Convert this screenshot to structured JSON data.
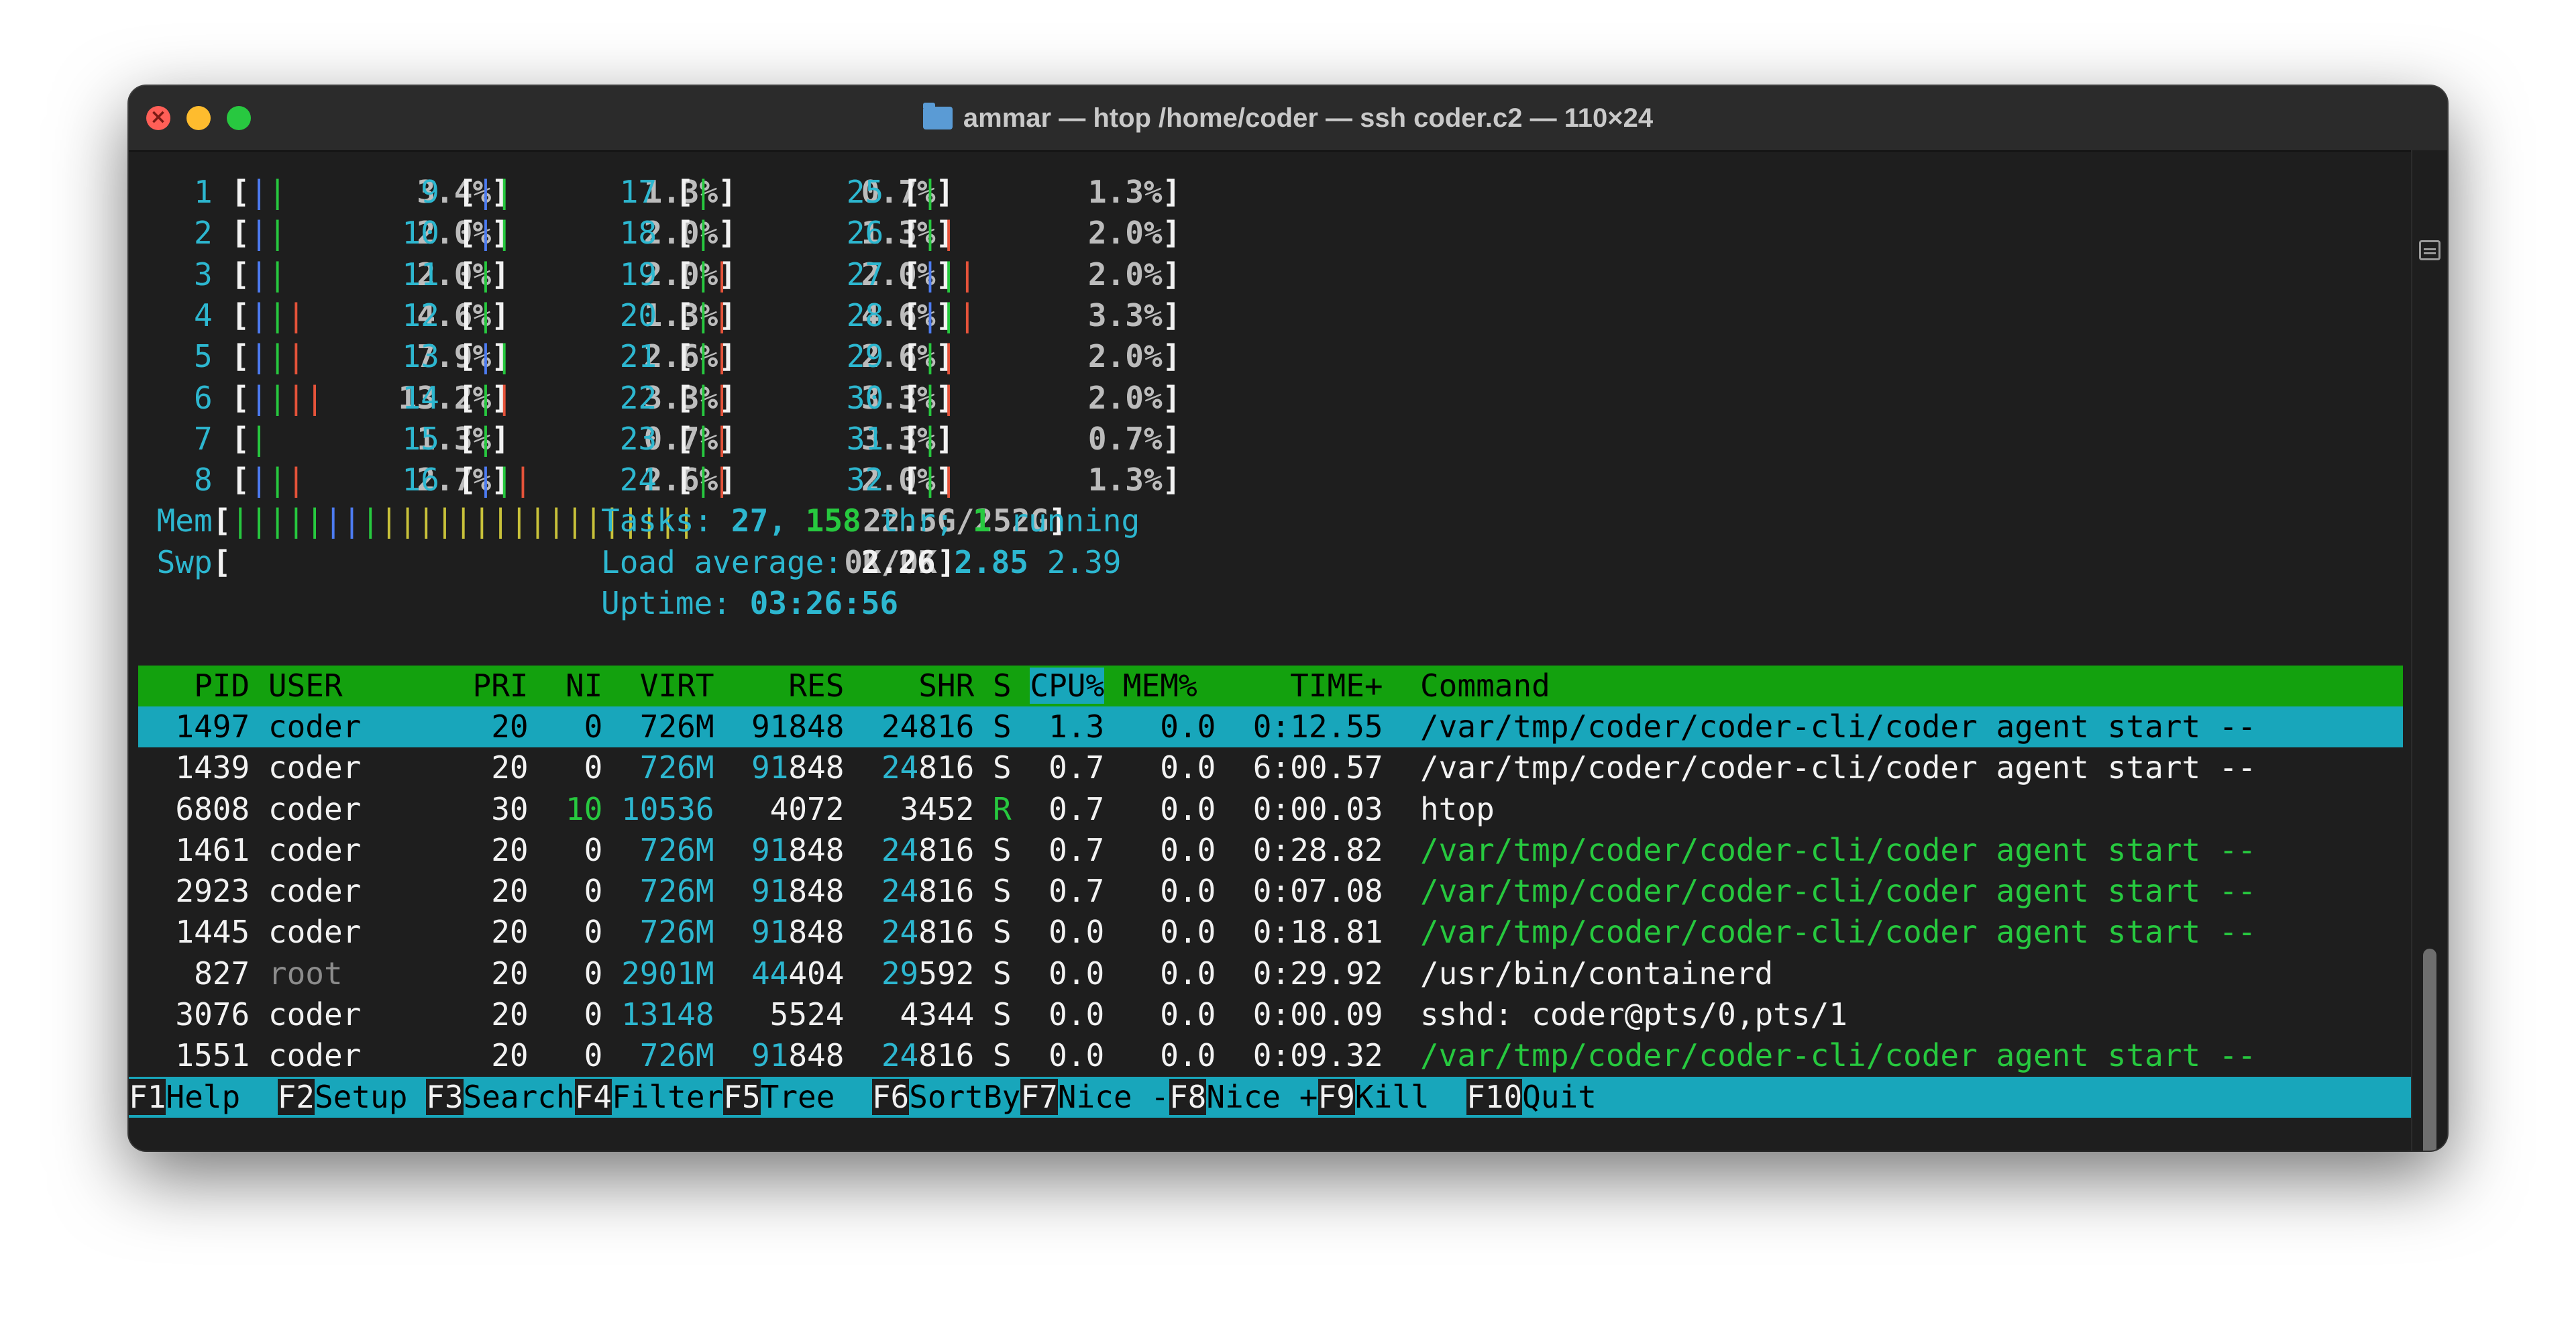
{
  "window": {
    "title": "ammar — htop /home/coder — ssh coder.c2 — 110×24",
    "folder_icon": "folder-icon"
  },
  "cpus": [
    {
      "id": "1",
      "bars": "||",
      "pct": "3.4%"
    },
    {
      "id": "2",
      "bars": "||",
      "pct": "2.0%"
    },
    {
      "id": "3",
      "bars": "||",
      "pct": "2.0%"
    },
    {
      "id": "4",
      "bars": "|||",
      "pct": "4.6%"
    },
    {
      "id": "5",
      "bars": "|||",
      "pct": "7.9%"
    },
    {
      "id": "6",
      "bars": "||||",
      "pct": "13.2%"
    },
    {
      "id": "7",
      "bars": "|",
      "pct": "1.3%"
    },
    {
      "id": "8",
      "bars": "|||",
      "pct": "2.7%"
    },
    {
      "id": "9",
      "bars": "||",
      "pct": "1.3%"
    },
    {
      "id": "10",
      "bars": "||",
      "pct": "2.0%"
    },
    {
      "id": "11",
      "bars": "|",
      "pct": "2.0%"
    },
    {
      "id": "12",
      "bars": "|",
      "pct": "1.3%"
    },
    {
      "id": "13",
      "bars": "||",
      "pct": "2.6%"
    },
    {
      "id": "14",
      "bars": "||",
      "pct": "3.3%"
    },
    {
      "id": "15",
      "bars": "|",
      "pct": "0.7%"
    },
    {
      "id": "16",
      "bars": "|||",
      "pct": "2.6%"
    },
    {
      "id": "17",
      "bars": "|",
      "pct": "0.7%"
    },
    {
      "id": "18",
      "bars": "|",
      "pct": "1.3%"
    },
    {
      "id": "19",
      "bars": "||",
      "pct": "2.0%"
    },
    {
      "id": "20",
      "bars": "||",
      "pct": "4.6%"
    },
    {
      "id": "21",
      "bars": "||",
      "pct": "2.6%"
    },
    {
      "id": "22",
      "bars": "||",
      "pct": "3.3%"
    },
    {
      "id": "23",
      "bars": "||",
      "pct": "3.3%"
    },
    {
      "id": "24",
      "bars": "||",
      "pct": "2.0%"
    },
    {
      "id": "25",
      "bars": "|",
      "pct": "1.3%"
    },
    {
      "id": "26",
      "bars": "||",
      "pct": "2.0%"
    },
    {
      "id": "27",
      "bars": "|||",
      "pct": "2.0%"
    },
    {
      "id": "28",
      "bars": "|||",
      "pct": "3.3%"
    },
    {
      "id": "29",
      "bars": "||",
      "pct": "2.0%"
    },
    {
      "id": "30",
      "bars": "||",
      "pct": "2.0%"
    },
    {
      "id": "31",
      "bars": "|",
      "pct": "0.7%"
    },
    {
      "id": "32",
      "bars": "||",
      "pct": "1.3%"
    }
  ],
  "mem": {
    "label": "Mem",
    "value": "22.5G/252G",
    "fraction": 0.09
  },
  "swp": {
    "label": "Swp",
    "value": "0K/0K",
    "fraction": 0
  },
  "tasks": {
    "label": "Tasks:",
    "count": "27,",
    "thr": "158",
    "thr_label": "thr;",
    "running": "1",
    "running_label": "running"
  },
  "load": {
    "label": "Load average:",
    "l1": "2.26",
    "l5": "2.85",
    "l15": "2.39"
  },
  "uptime": {
    "label": "Uptime:",
    "value": "03:26:56"
  },
  "table": {
    "headers": {
      "pid": "PID",
      "user": "USER",
      "pri": "PRI",
      "ni": "NI",
      "virt": "VIRT",
      "res": "RES",
      "shr": "SHR",
      "s": "S",
      "cpu": "CPU%",
      "mem": "MEM%",
      "time": "TIME+",
      "cmd": "Command"
    },
    "rows": [
      {
        "pid": "1497",
        "user": "coder",
        "pri": "20",
        "ni": "0",
        "virt": "726M",
        "res": "91848",
        "shr": "24816",
        "s": "S",
        "cpu": "1.3",
        "mem": "0.0",
        "time": "0:12.55",
        "cmd": "/var/tmp/coder/coder-cli/coder agent start --"
      },
      {
        "pid": "1439",
        "user": "coder",
        "pri": "20",
        "ni": "0",
        "virt": "726M",
        "res": "91848",
        "shr": "24816",
        "s": "S",
        "cpu": "0.7",
        "mem": "0.0",
        "time": "6:00.57",
        "cmd": "/var/tmp/coder/coder-cli/coder agent start --"
      },
      {
        "pid": "6808",
        "user": "coder",
        "pri": "30",
        "ni": "10",
        "virt": "10536",
        "res": "4072",
        "shr": "3452",
        "s": "R",
        "cpu": "0.7",
        "mem": "0.0",
        "time": "0:00.03",
        "cmd": "htop"
      },
      {
        "pid": "1461",
        "user": "coder",
        "pri": "20",
        "ni": "0",
        "virt": "726M",
        "res": "91848",
        "shr": "24816",
        "s": "S",
        "cpu": "0.7",
        "mem": "0.0",
        "time": "0:28.82",
        "cmd": "/var/tmp/coder/coder-cli/coder agent start --"
      },
      {
        "pid": "2923",
        "user": "coder",
        "pri": "20",
        "ni": "0",
        "virt": "726M",
        "res": "91848",
        "shr": "24816",
        "s": "S",
        "cpu": "0.7",
        "mem": "0.0",
        "time": "0:07.08",
        "cmd": "/var/tmp/coder/coder-cli/coder agent start --"
      },
      {
        "pid": "1445",
        "user": "coder",
        "pri": "20",
        "ni": "0",
        "virt": "726M",
        "res": "91848",
        "shr": "24816",
        "s": "S",
        "cpu": "0.0",
        "mem": "0.0",
        "time": "0:18.81",
        "cmd": "/var/tmp/coder/coder-cli/coder agent start --"
      },
      {
        "pid": "827",
        "user": "root",
        "pri": "20",
        "ni": "0",
        "virt": "2901M",
        "res": "44404",
        "shr": "29592",
        "s": "S",
        "cpu": "0.0",
        "mem": "0.0",
        "time": "0:29.92",
        "cmd": "/usr/bin/containerd"
      },
      {
        "pid": "3076",
        "user": "coder",
        "pri": "20",
        "ni": "0",
        "virt": "13148",
        "res": "5524",
        "shr": "4344",
        "s": "S",
        "cpu": "0.0",
        "mem": "0.0",
        "time": "0:00.09",
        "cmd": "sshd: coder@pts/0,pts/1"
      },
      {
        "pid": "1551",
        "user": "coder",
        "pri": "20",
        "ni": "0",
        "virt": "726M",
        "res": "91848",
        "shr": "24816",
        "s": "S",
        "cpu": "0.0",
        "mem": "0.0",
        "time": "0:09.32",
        "cmd": "/var/tmp/coder/coder-cli/coder agent start --"
      }
    ]
  },
  "fkeys": [
    {
      "key": "F1",
      "label": "Help  "
    },
    {
      "key": "F2",
      "label": "Setup "
    },
    {
      "key": "F3",
      "label": "Search"
    },
    {
      "key": "F4",
      "label": "Filter"
    },
    {
      "key": "F5",
      "label": "Tree  "
    },
    {
      "key": "F6",
      "label": "SortBy"
    },
    {
      "key": "F7",
      "label": "Nice -"
    },
    {
      "key": "F8",
      "label": "Nice +"
    },
    {
      "key": "F9",
      "label": "Kill  "
    },
    {
      "key": "F10",
      "label": "Quit"
    }
  ],
  "colors": {
    "header_bg": "#13a10e",
    "selected_bg": "#18a6bb",
    "cyan": "#2db7d0",
    "green": "#27c93f",
    "terminal_bg": "#1e1e1e"
  }
}
